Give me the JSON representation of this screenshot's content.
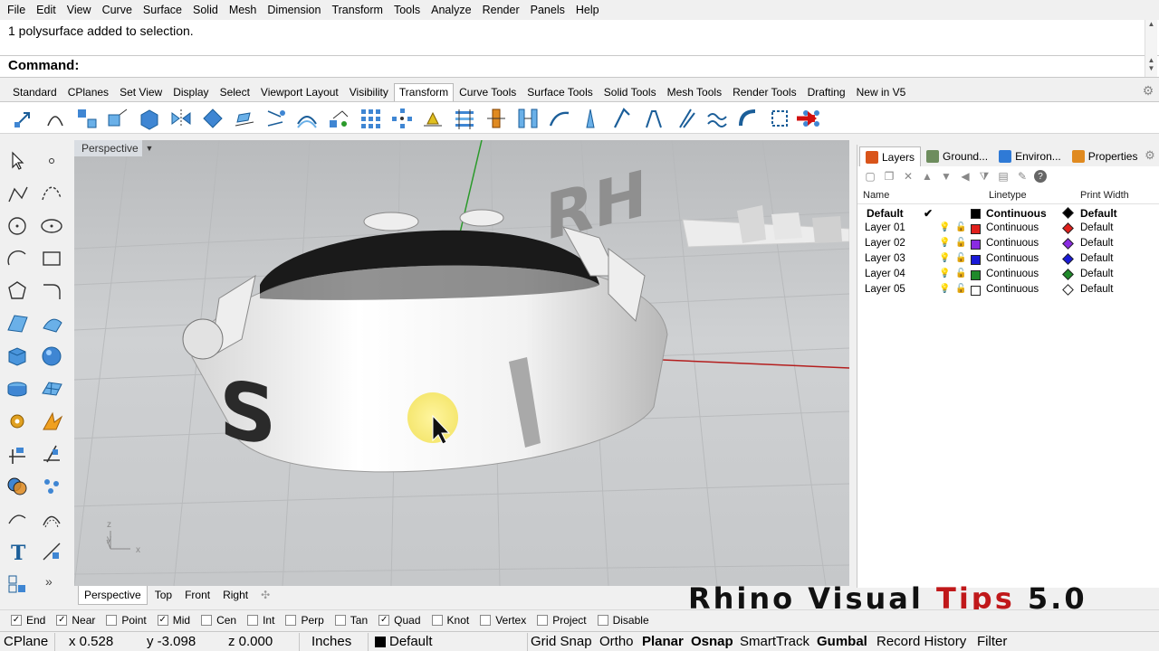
{
  "menu": [
    "File",
    "Edit",
    "View",
    "Curve",
    "Surface",
    "Solid",
    "Mesh",
    "Dimension",
    "Transform",
    "Tools",
    "Analyze",
    "Render",
    "Panels",
    "Help"
  ],
  "history": {
    "line": "1 polysurface added to selection."
  },
  "command": {
    "label": "Command:"
  },
  "toolbar_tabs": [
    "Standard",
    "CPlanes",
    "Set View",
    "Display",
    "Select",
    "Viewport Layout",
    "Visibility",
    "Transform",
    "Curve Tools",
    "Surface Tools",
    "Solid Tools",
    "Mesh Tools",
    "Render Tools",
    "Drafting",
    "New in V5"
  ],
  "toolbar_active_tab": "Transform",
  "toolbar_icons": [
    "move-icon",
    "copy-icon",
    "rotate-icon",
    "scale-icon",
    "scale-3d-icon",
    "mirror-icon",
    "orient-icon",
    "flow-icon",
    "twist-icon",
    "bend-icon",
    "taper-icon",
    "array-icon",
    "array-polar-icon",
    "align-icon",
    "distribute-icon",
    "project-icon",
    "set-points-icon",
    "cage-edit-icon",
    "flow-surface-icon",
    "splop-icon",
    "shear-icon",
    "stretch-icon",
    "smash-icon",
    "wave-icon",
    "bend-along-icon",
    "cage-icon",
    "red-arrow-icon"
  ],
  "viewport": {
    "title": "Perspective",
    "axis_labels": {
      "z": "z",
      "y": "y",
      "x": "x"
    }
  },
  "viewport_tabs": [
    "Perspective",
    "Top",
    "Front",
    "Right"
  ],
  "viewport_active_tab": "Perspective",
  "panel": {
    "tabs": [
      {
        "label": "Layers",
        "icon_color": "#d9541a"
      },
      {
        "label": "Ground...",
        "icon_color": "#6e8d5e"
      },
      {
        "label": "Environ...",
        "icon_color": "#2f7ad6"
      },
      {
        "label": "Properties",
        "icon_color": "#e08a20"
      }
    ],
    "columns": {
      "name": "Name",
      "linetype": "Linetype",
      "print_width": "Print Width"
    },
    "layers": [
      {
        "name": "Default",
        "current": "✔",
        "color": "#000000",
        "linetype": "Continuous",
        "print_color": "#000000",
        "print_width": "Default"
      },
      {
        "name": "Layer 01",
        "current": "",
        "color": "#e0201c",
        "linetype": "Continuous",
        "print_color": "#e0201c",
        "print_width": "Default"
      },
      {
        "name": "Layer 02",
        "current": "",
        "color": "#8a2be2",
        "linetype": "Continuous",
        "print_color": "#8a2be2",
        "print_width": "Default"
      },
      {
        "name": "Layer 03",
        "current": "",
        "color": "#1a1ad8",
        "linetype": "Continuous",
        "print_color": "#1a1ad8",
        "print_width": "Default"
      },
      {
        "name": "Layer 04",
        "current": "",
        "color": "#1f8a2a",
        "linetype": "Continuous",
        "print_color": "#1f8a2a",
        "print_width": "Default"
      },
      {
        "name": "Layer 05",
        "current": "",
        "color": "#ffffff",
        "linetype": "Continuous",
        "print_color": "#ffffff",
        "print_width": "Default"
      }
    ]
  },
  "watermark": {
    "part1": "Rhino Visual ",
    "part2": "Tips",
    "part3": " 5.0"
  },
  "osnap": [
    {
      "label": "End",
      "checked": true
    },
    {
      "label": "Near",
      "checked": true
    },
    {
      "label": "Point",
      "checked": false
    },
    {
      "label": "Mid",
      "checked": true
    },
    {
      "label": "Cen",
      "checked": false
    },
    {
      "label": "Int",
      "checked": false
    },
    {
      "label": "Perp",
      "checked": false
    },
    {
      "label": "Tan",
      "checked": false
    },
    {
      "label": "Quad",
      "checked": true
    },
    {
      "label": "Knot",
      "checked": false
    },
    {
      "label": "Vertex",
      "checked": false
    },
    {
      "label": "Project",
      "checked": false
    },
    {
      "label": "Disable",
      "checked": false
    }
  ],
  "status": {
    "cplane": "CPlane",
    "x": "x 0.528",
    "y": "y -3.098",
    "z": "z 0.000",
    "units": "Inches",
    "layer": "Default",
    "toggles": [
      {
        "label": "Grid Snap",
        "bold": false
      },
      {
        "label": "Ortho",
        "bold": false
      },
      {
        "label": "Planar",
        "bold": true
      },
      {
        "label": "Osnap",
        "bold": true
      },
      {
        "label": "SmartTrack",
        "bold": false
      },
      {
        "label": "Gumbal",
        "bold": true
      },
      {
        "label": "Record History",
        "bold": false
      },
      {
        "label": "Filter",
        "bold": false
      }
    ]
  },
  "colors": {
    "accent_red": "#c0181a",
    "viewport_bg": "#c8cacc",
    "x_axis": "#b41e1e",
    "y_axis": "#2a9a2a"
  }
}
